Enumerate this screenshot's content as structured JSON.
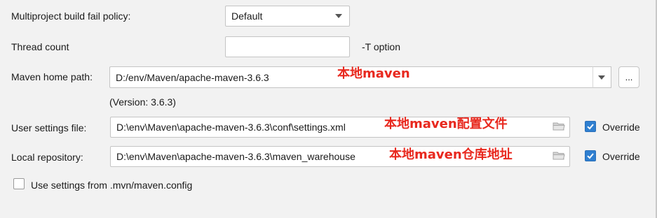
{
  "multiproject": {
    "label": "Multiproject build fail policy:",
    "value": "Default"
  },
  "thread_count": {
    "label": "Thread count",
    "value": "",
    "hint": "-T option"
  },
  "maven_home": {
    "label": "Maven home path:",
    "value": "D:/env/Maven/apache-maven-3.6.3",
    "browse_label": "...",
    "version": "(Version: 3.6.3)",
    "annotation": "本地maven"
  },
  "user_settings": {
    "label": "User settings file:",
    "value": "D:\\env\\Maven\\apache-maven-3.6.3\\conf\\settings.xml",
    "annotation": "本地maven配置文件",
    "override_label": "Override",
    "override_checked": true
  },
  "local_repo": {
    "label": "Local repository:",
    "value": "D:\\env\\Maven\\apache-maven-3.6.3\\maven_warehouse",
    "annotation": "本地maven仓库地址",
    "override_label": "Override",
    "override_checked": true
  },
  "mvn_config": {
    "label": "Use settings from .mvn/maven.config",
    "checked": false
  },
  "colors": {
    "background": "#f2f2f2",
    "annotation": "#e8281e",
    "checkbox_accent": "#2f7fd0"
  },
  "icons": [
    "chevron-down-icon",
    "folder-icon",
    "check-icon"
  ]
}
